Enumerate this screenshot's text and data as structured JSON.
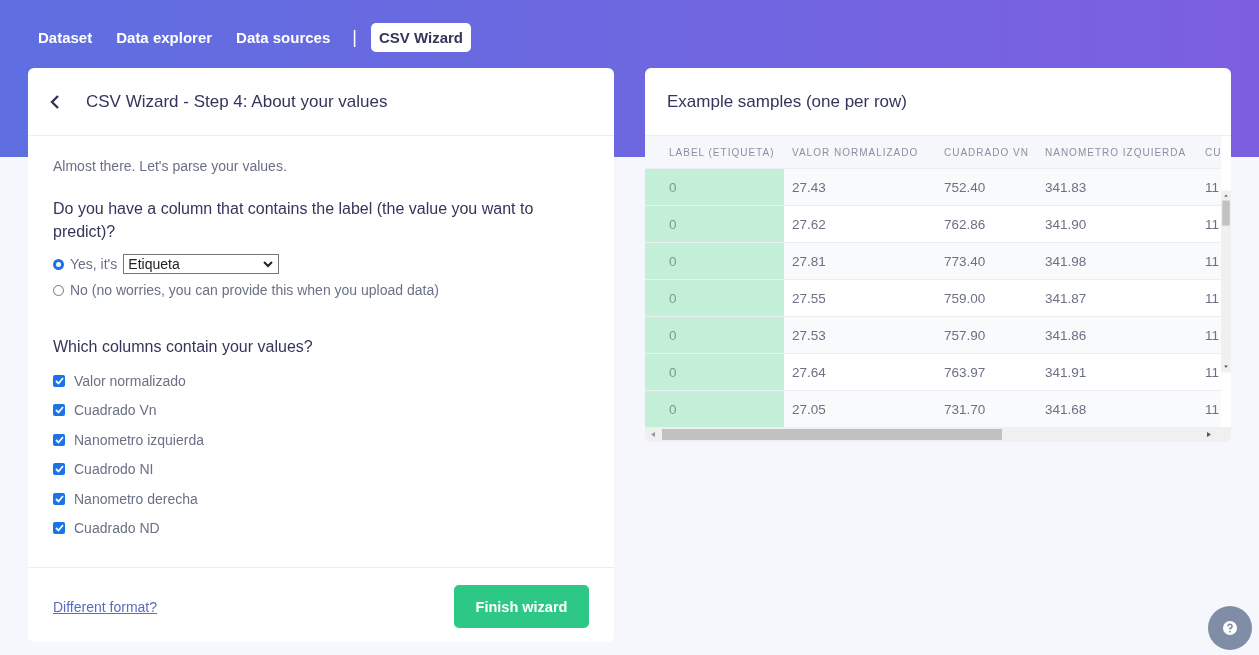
{
  "nav": {
    "tabs": [
      {
        "label": "Dataset",
        "selected": false
      },
      {
        "label": "Data explorer",
        "selected": false
      },
      {
        "label": "Data sources",
        "selected": false
      },
      {
        "label": "CSV Wizard",
        "selected": true
      }
    ],
    "separator": "|"
  },
  "wizard": {
    "title": "CSV Wizard - Step 4: About your values",
    "intro": "Almost there. Let's parse your values.",
    "label_question": "Do you have a column that contains the label (the value you want to predict)?",
    "label_options": [
      {
        "kind": "select",
        "label": "Yes, it's",
        "value": "Etiqueta",
        "selected": true
      },
      {
        "kind": "plain",
        "label": "No (no worries, you can provide this when you upload data)",
        "selected": false
      }
    ],
    "values_question": "Which columns contain your values?",
    "value_columns": [
      {
        "label": "Valor normalizado",
        "checked": true
      },
      {
        "label": "Cuadrado Vn",
        "checked": true
      },
      {
        "label": "Nanometro izquierda",
        "checked": true
      },
      {
        "label": "Cuadrodo NI",
        "checked": true
      },
      {
        "label": "Nanometro derecha",
        "checked": true
      },
      {
        "label": "Cuadrado ND",
        "checked": true
      }
    ],
    "footer_link": "Different format?",
    "finish_button": "Finish wizard"
  },
  "samples": {
    "title": "Example samples (one per row)",
    "columns": [
      "LABEL (ETIQUETA)",
      "VALOR NORMALIZADO",
      "CUADRADO VN",
      "NANOMETRO IZQUIERDA",
      "CU"
    ],
    "rows": [
      [
        "0",
        "27.43",
        "752.40",
        "341.83",
        "11"
      ],
      [
        "0",
        "27.62",
        "762.86",
        "341.90",
        "11"
      ],
      [
        "0",
        "27.81",
        "773.40",
        "341.98",
        "11"
      ],
      [
        "0",
        "27.55",
        "759.00",
        "341.87",
        "11"
      ],
      [
        "0",
        "27.53",
        "757.90",
        "341.86",
        "11"
      ],
      [
        "0",
        "27.64",
        "763.97",
        "341.91",
        "11"
      ],
      [
        "0",
        "27.05",
        "731.70",
        "341.68",
        "11"
      ]
    ]
  }
}
